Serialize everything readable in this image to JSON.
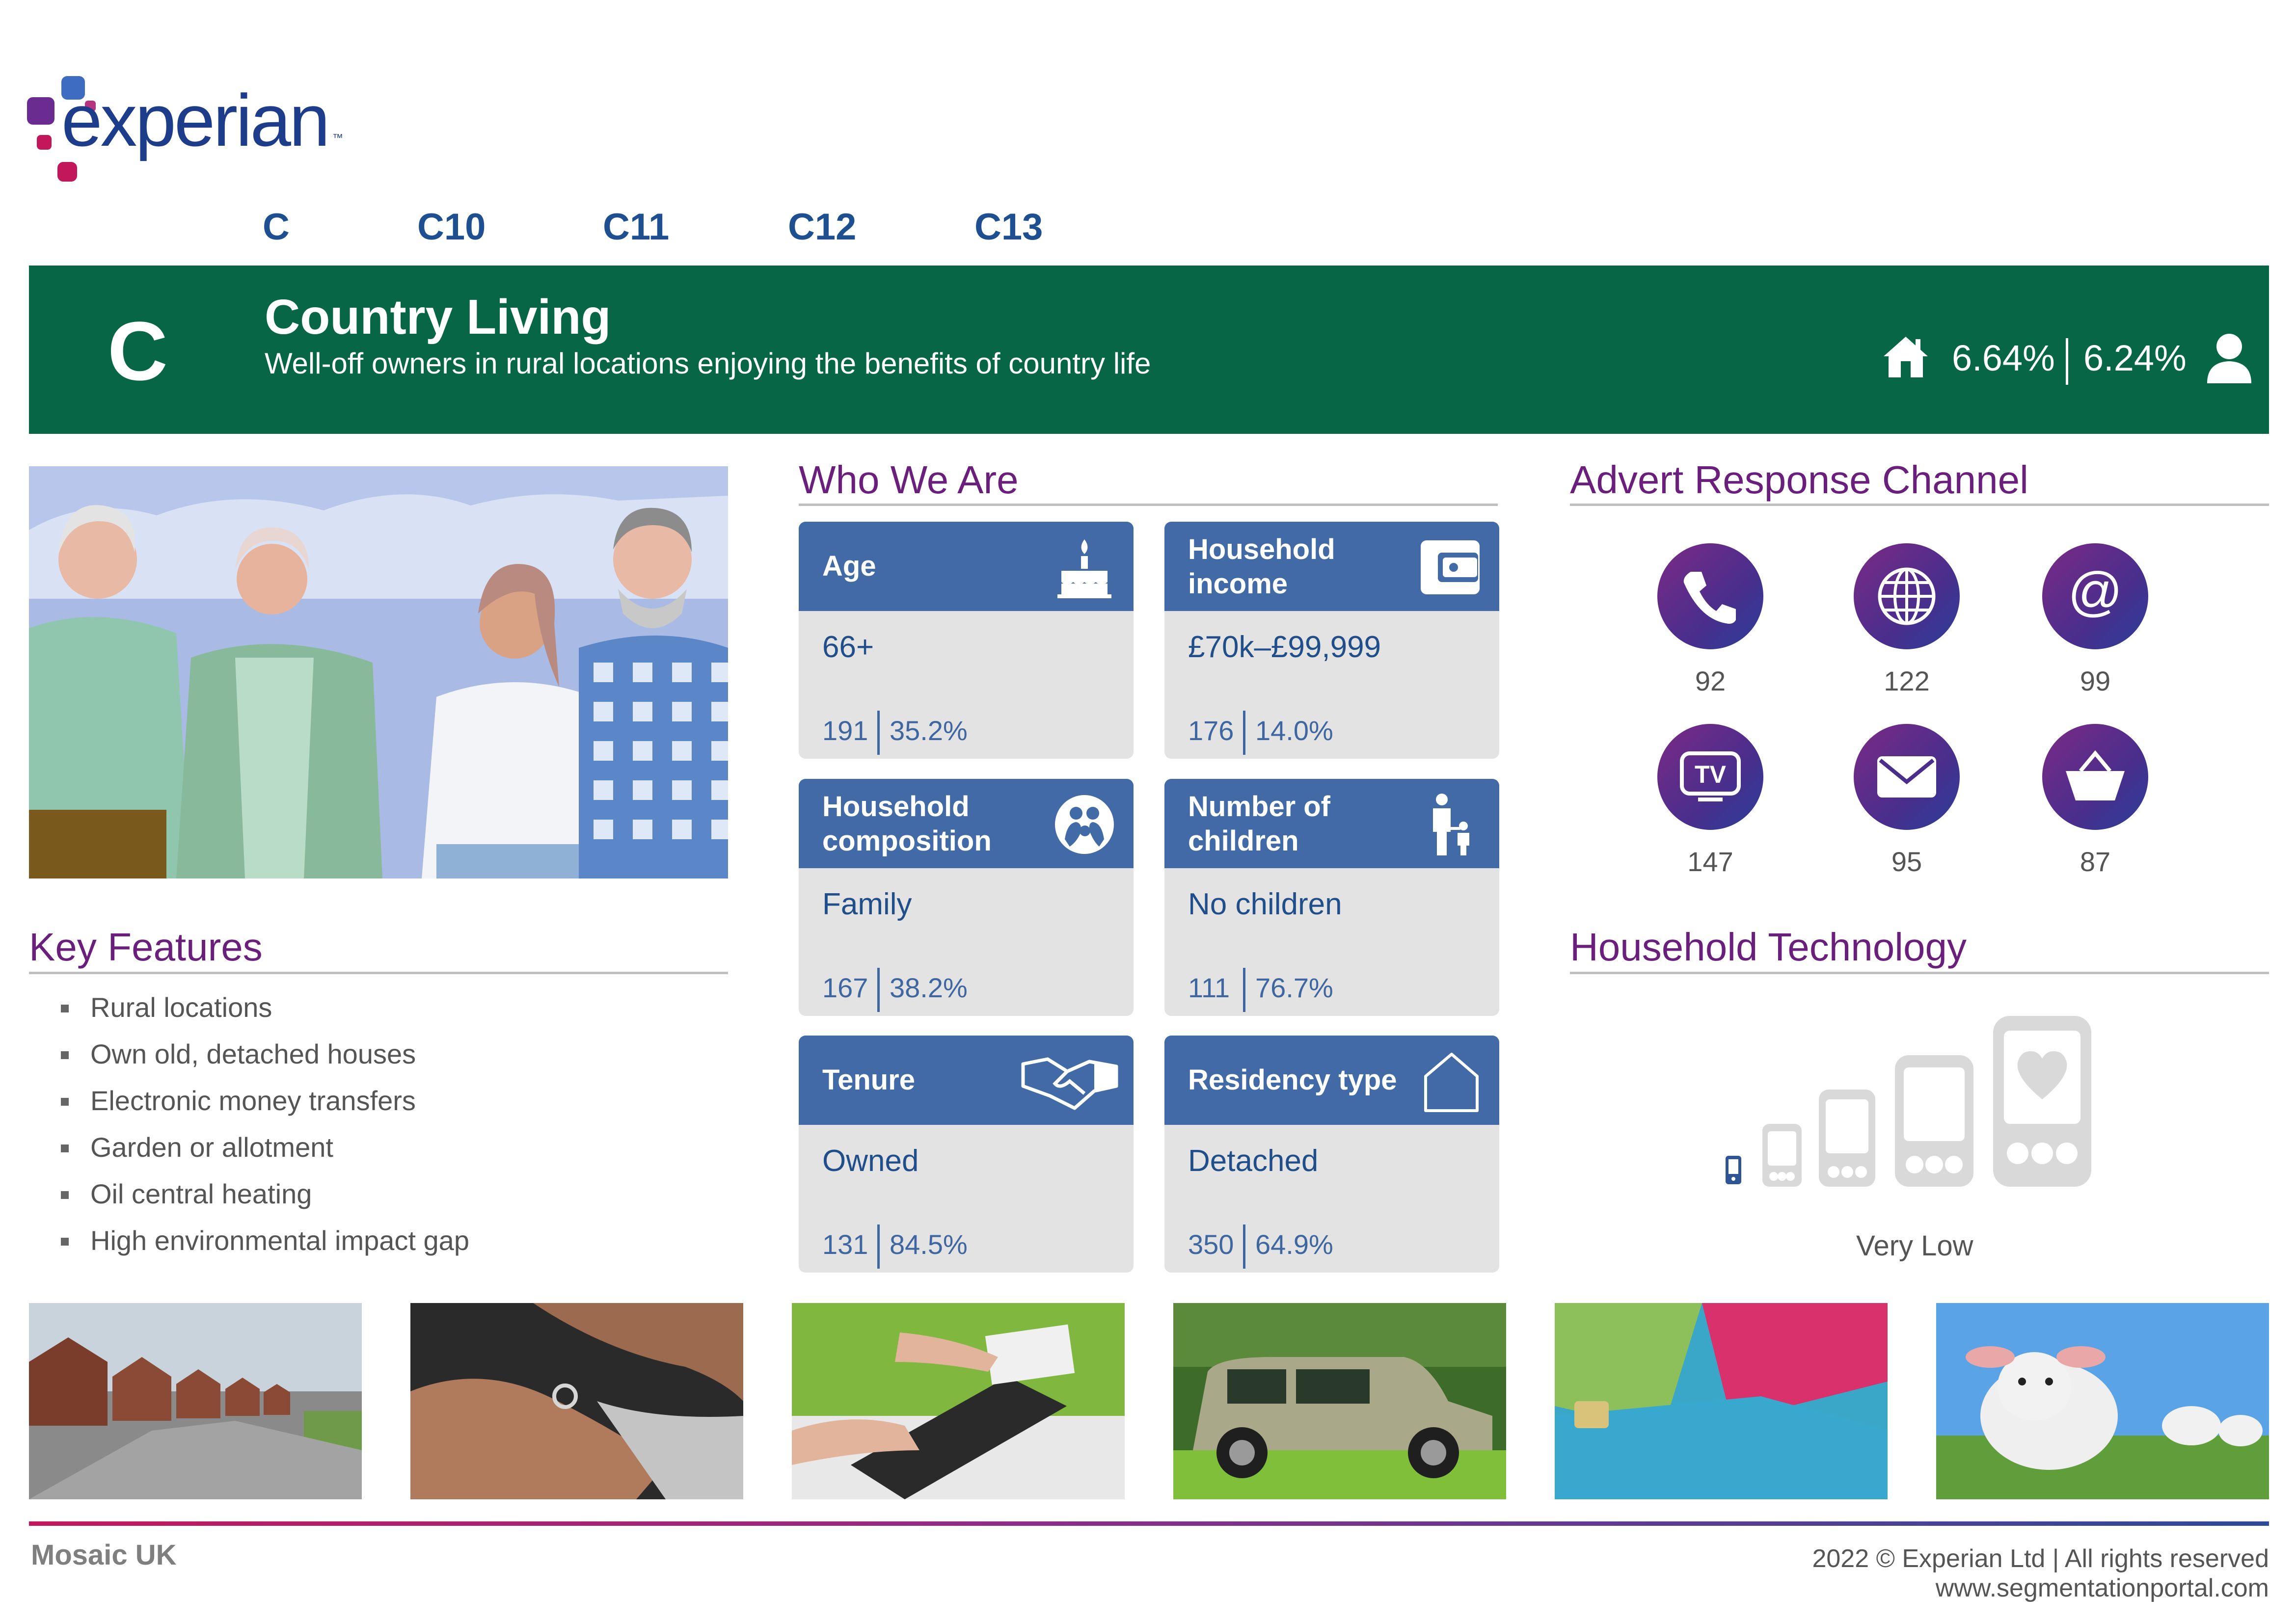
{
  "brand": {
    "logo_text": "experian",
    "logo_tm": "™"
  },
  "tabs": [
    "C",
    "C10",
    "C11",
    "C12",
    "C13"
  ],
  "banner": {
    "letter": "C",
    "title": "Country Living",
    "subtitle": "Well-off owners in rural locations enjoying the benefits of country life",
    "households_pct": "6.64%",
    "population_pct": "6.24%",
    "color": "#066645"
  },
  "key_features": {
    "title": "Key Features",
    "items": [
      "Rural locations",
      "Own old, detached houses",
      "Electronic money transfers",
      "Garden or allotment",
      "Oil central heating",
      "High environmental impact gap"
    ]
  },
  "who_we_are": {
    "title": "Who We Are",
    "cards": [
      {
        "title_lines": [
          "Age"
        ],
        "value": "66+",
        "index": "191",
        "pct": "35.2%",
        "icon": "cake-icon"
      },
      {
        "title_lines": [
          "Household",
          "income"
        ],
        "value": "£70k–£99,999",
        "index": "176",
        "pct": "14.0%",
        "icon": "wallet-icon"
      },
      {
        "title_lines": [
          "Household",
          "composition"
        ],
        "value": "Family",
        "index": "167",
        "pct": "38.2%",
        "icon": "family-icon"
      },
      {
        "title_lines": [
          "Number of",
          "children"
        ],
        "value": "No children",
        "index": "111",
        "pct": "76.7%",
        "icon": "adult-child-icon"
      },
      {
        "title_lines": [
          "Tenure"
        ],
        "value": "Owned",
        "index": "131",
        "pct": "84.5%",
        "icon": "handshake-icon"
      },
      {
        "title_lines": [
          "Residency type"
        ],
        "value": "Detached",
        "index": "350",
        "pct": "64.9%",
        "icon": "house-outline-icon"
      }
    ]
  },
  "advert_response": {
    "title": "Advert Response Channel",
    "channels": [
      {
        "icon": "phone-icon",
        "value": "92"
      },
      {
        "icon": "web-icon",
        "value": "122"
      },
      {
        "icon": "email-icon",
        "value": "99"
      },
      {
        "icon": "tv-icon",
        "value": "147"
      },
      {
        "icon": "mail-icon",
        "value": "95"
      },
      {
        "icon": "basket-icon",
        "value": "87"
      }
    ]
  },
  "household_technology": {
    "title": "Household Technology",
    "level": "Very Low",
    "level_rank": 1,
    "level_of": 5
  },
  "photos": [
    "houses-photo",
    "ring-photo",
    "tablet-photo",
    "car-photo",
    "cards-photo",
    "lamb-photo"
  ],
  "footer": {
    "left": "Mosaic UK",
    "copyright": "2022 © Experian Ltd | All rights reserved",
    "url": "www.segmentationportal.com"
  }
}
